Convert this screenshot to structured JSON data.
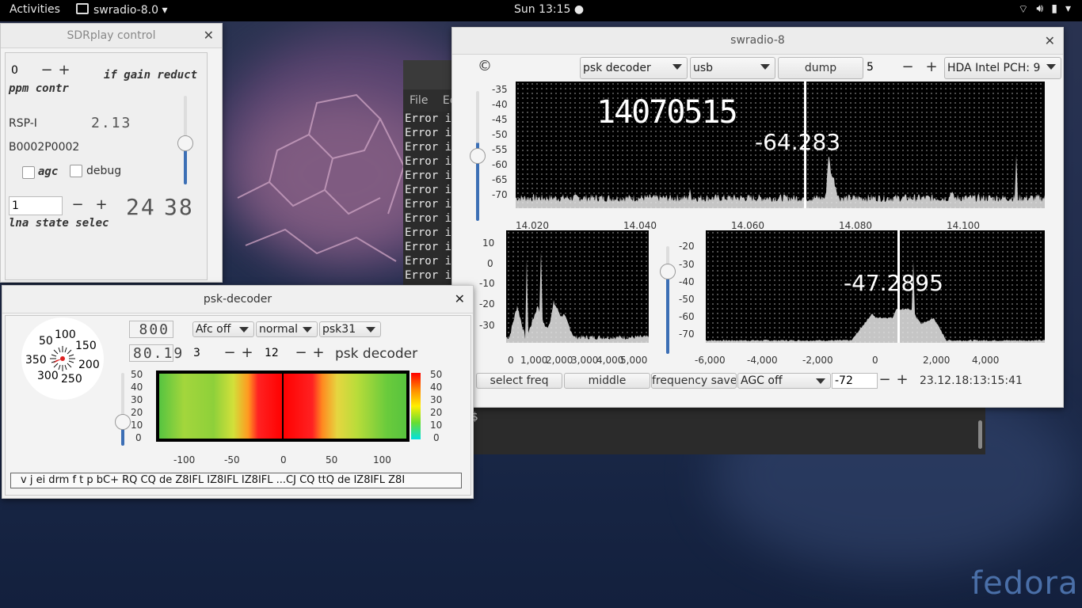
{
  "topbar": {
    "activities": "Activities",
    "app": "swradio-8.0",
    "clock": "Sun 13:15"
  },
  "branding": {
    "logo": "fedora"
  },
  "terminal": {
    "menu": [
      "File",
      "Ed"
    ],
    "error_line": "Error i",
    "tail_line": "...",
    "prompt": "$"
  },
  "sdrplay": {
    "title": "SDRplay control",
    "ppm_value": "0",
    "ppm_label": "ppm contr",
    "if_gain_label": "if gain reduct",
    "device": "RSP-I",
    "api_version": "2.13",
    "serial": "B0002P0002",
    "agc_label": "agc",
    "debug_label": "debug",
    "lna_value": "1",
    "lna_label": "lna state selec",
    "gain_a": "24",
    "gain_b": "38"
  },
  "psk": {
    "title": "psk-decoder",
    "dial_labels": [
      "50",
      "100",
      "150",
      "200",
      "250",
      "300",
      "350"
    ],
    "lcd1": "800",
    "lcd2": "80.19",
    "afc": "Afc off",
    "mode": "normal",
    "psk_type": "psk31",
    "spin1": "3",
    "spin2": "12",
    "decoder_label": "psk decoder",
    "wf_y_ticks": [
      "50",
      "40",
      "30",
      "20",
      "10",
      "0"
    ],
    "wf_x_ticks": [
      "-100",
      "-50",
      "0",
      "50",
      "100"
    ],
    "scale_ticks": [
      "50",
      "40",
      "30",
      "20",
      "10",
      "0"
    ],
    "decoded_text": "v    j ei drm   f  t p bC+ RQ CQ de Z8IFL IZ8IFL IZ8IFL ...CJ CQ ttQ de IZ8IFL Z8I"
  },
  "swradio": {
    "title": "swradio-8",
    "copyright": "©",
    "decoder_select": "psk decoder",
    "mode_select": "usb",
    "dump_label": "dump",
    "spin_value": "5",
    "soundcard": "HDA Intel PCH: 9",
    "main_freq": "14070515",
    "main_level": "-64.283",
    "main_y_ticks": [
      "-35",
      "-40",
      "-45",
      "-50",
      "-55",
      "-60",
      "-65",
      "-70"
    ],
    "main_x_ticks": [
      "14.020",
      "14.040",
      "14.060",
      "14.080",
      "14.100"
    ],
    "left_y_ticks": [
      "10",
      "0",
      "-10",
      "-20",
      "-30"
    ],
    "left_x_ticks": [
      "0",
      "1,000",
      "2,000",
      "3,000",
      "4,000",
      "5,000"
    ],
    "right_level": "-47.2895",
    "right_y_ticks": [
      "-20",
      "-30",
      "-40",
      "-50",
      "-60",
      "-70"
    ],
    "right_x_ticks": [
      "-6,000",
      "-4,000",
      "-2,000",
      "0",
      "2,000",
      "4,000"
    ],
    "select_freq": "select freq",
    "middle": "middle",
    "frequency_save": "frequency save",
    "agc_select": "AGC off",
    "agc_value": "-72",
    "timestamp": "23.12.18:13:15:41"
  }
}
